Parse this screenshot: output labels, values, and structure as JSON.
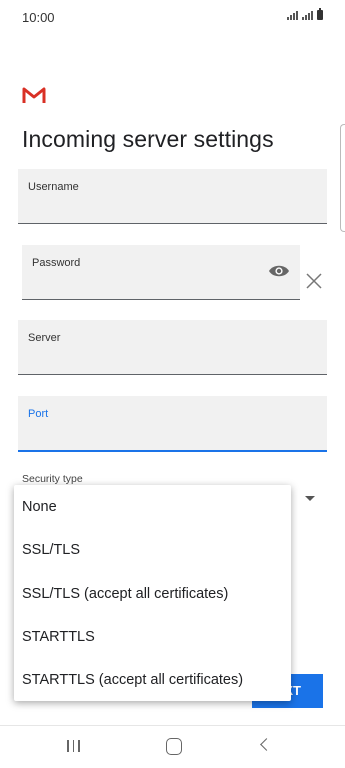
{
  "status_bar": {
    "time": "10:00"
  },
  "header": {
    "title": "Incoming server settings"
  },
  "fields": {
    "username": {
      "label": "Username",
      "value": ""
    },
    "password": {
      "label": "Password",
      "value": ""
    },
    "server": {
      "label": "Server",
      "value": ""
    },
    "port": {
      "label": "Port",
      "value": ""
    }
  },
  "security": {
    "label": "Security type",
    "options": [
      "None",
      "SSL/TLS",
      "SSL/TLS (accept all certificates)",
      "STARTTLS",
      "STARTTLS (accept all certificates)"
    ]
  },
  "buttons": {
    "next_label": "XT"
  },
  "colors": {
    "accent": "#1a73e8",
    "gmail_red": "#d93025",
    "field_bg": "#f1f1f1"
  }
}
